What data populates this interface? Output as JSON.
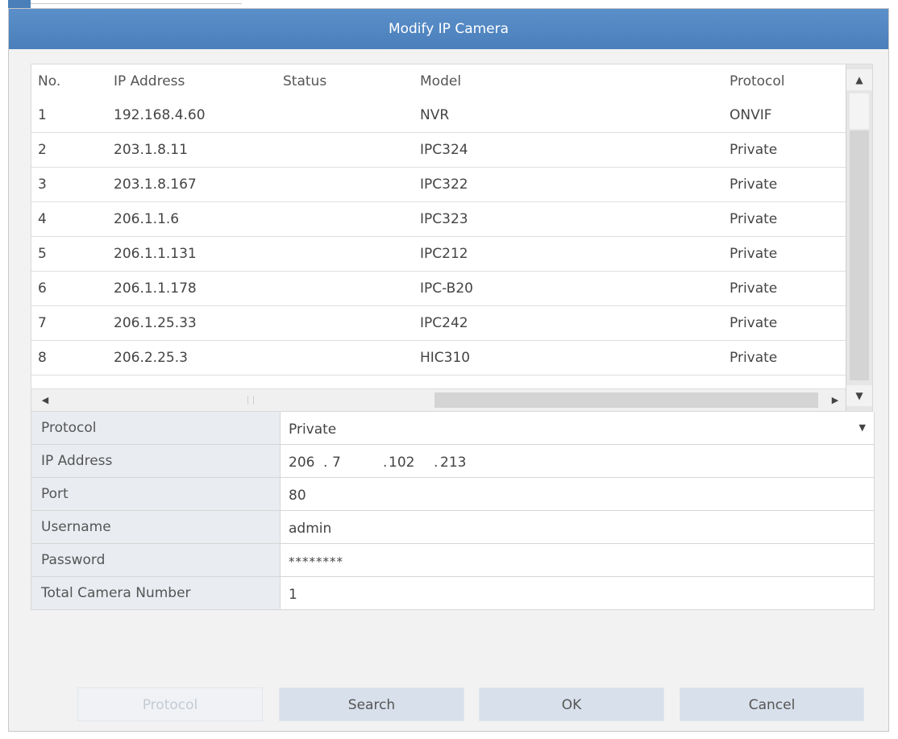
{
  "dialog": {
    "title": "Modify IP Camera"
  },
  "table": {
    "headers": {
      "no": "No.",
      "ip": "IP Address",
      "status": "Status",
      "model": "Model",
      "protocol": "Protocol"
    },
    "rows": [
      {
        "no": "1",
        "ip": "192.168.4.60",
        "status": "",
        "model": "NVR",
        "protocol": "ONVIF"
      },
      {
        "no": "2",
        "ip": "203.1.8.11",
        "status": "",
        "model": "IPC324",
        "protocol": "Private"
      },
      {
        "no": "3",
        "ip": "203.1.8.167",
        "status": "",
        "model": "IPC322",
        "protocol": "Private"
      },
      {
        "no": "4",
        "ip": "206.1.1.6",
        "status": "",
        "model": "IPC323",
        "protocol": "Private"
      },
      {
        "no": "5",
        "ip": "206.1.1.131",
        "status": "",
        "model": "IPC212",
        "protocol": "Private"
      },
      {
        "no": "6",
        "ip": "206.1.1.178",
        "status": "",
        "model": "IPC-B20",
        "protocol": "Private"
      },
      {
        "no": "7",
        "ip": "206.1.25.33",
        "status": "",
        "model": "IPC242",
        "protocol": "Private"
      },
      {
        "no": "8",
        "ip": "206.2.25.3",
        "status": "",
        "model": "HIC310",
        "protocol": "Private"
      }
    ]
  },
  "form": {
    "protocol": {
      "label": "Protocol",
      "value": "Private"
    },
    "ip_address": {
      "label": "IP Address",
      "octets": [
        "206",
        "7",
        "102",
        "213"
      ],
      "separator": "."
    },
    "port": {
      "label": "Port",
      "value": "80"
    },
    "username": {
      "label": "Username",
      "value": "admin"
    },
    "password": {
      "label": "Password",
      "value": "********"
    },
    "total_camera_number": {
      "label": "Total Camera Number",
      "value": "1"
    }
  },
  "buttons": {
    "protocol": "Protocol",
    "search": "Search",
    "ok": "OK",
    "cancel": "Cancel"
  },
  "icons": {
    "scroll_up": "▲",
    "scroll_down": "▼",
    "scroll_left": "◀",
    "scroll_right": "▶",
    "dropdown": "▼"
  }
}
